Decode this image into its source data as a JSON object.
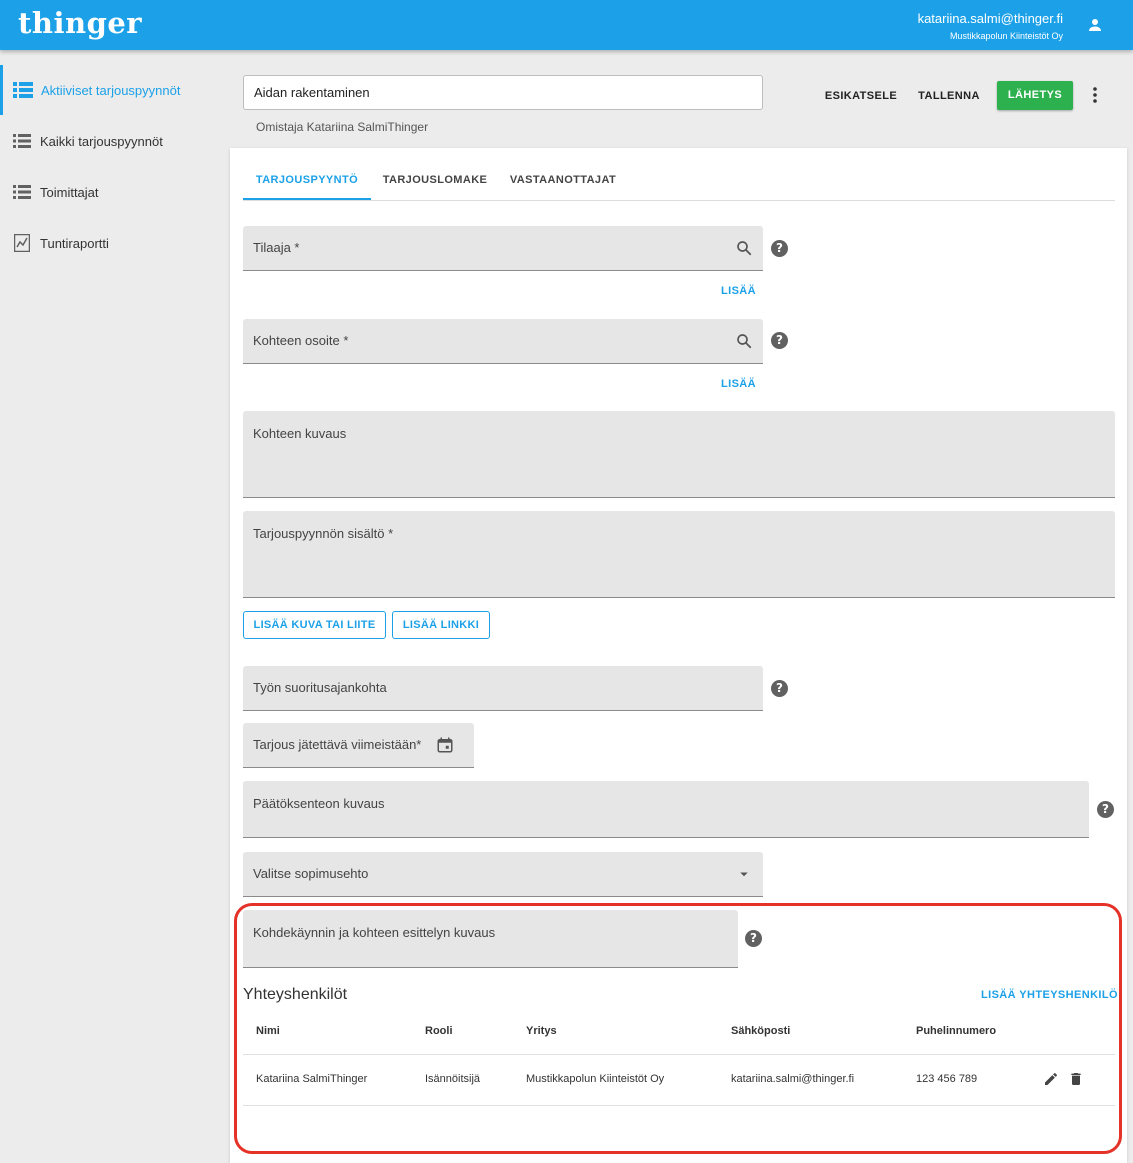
{
  "app": {
    "logo": "thinger",
    "user_email": "katariina.salmi@thinger.fi",
    "user_company": "Mustikkapolun Kiinteistöt Oy",
    "accent_color": "#1ca1e8",
    "send_color": "#2db14f",
    "highlight_color": "#e53228"
  },
  "sidebar": {
    "items": [
      {
        "label": "Aktiiviset tarjouspyynnöt",
        "icon": "grid-list-icon",
        "active": true
      },
      {
        "label": "Kaikki tarjouspyynnöt",
        "icon": "list-icon",
        "active": false
      },
      {
        "label": "Toimittajat",
        "icon": "list-icon",
        "active": false
      },
      {
        "label": "Tuntiraportti",
        "icon": "report-chart-icon",
        "active": false
      }
    ]
  },
  "header": {
    "title_value": "Aidan rakentaminen",
    "owner": "Omistaja Katariina SalmiThinger",
    "preview_label": "ESIKATSELE",
    "save_label": "TALLENNA",
    "send_label": "LÄHETYS"
  },
  "tabs": [
    "TARJOUSPYYNTÖ",
    "TARJOUSLOMAKE",
    "VASTAANOTTAJAT"
  ],
  "form": {
    "orderer_label": "Tilaaja *",
    "add_label": "LISÄÄ",
    "address_label": "Kohteen osoite *",
    "description_label": "Kohteen kuvaus",
    "content_label": "Tarjouspyynnön sisältö *",
    "add_attachment_label": "LISÄÄ KUVA TAI LIITE",
    "add_link_label": "LISÄÄ LINKKI",
    "work_time_label": "Työn suoritusajankohta",
    "deadline_label": "Tarjous jätettävä viimeistään*",
    "decision_label": "Päätöksenteon kuvaus",
    "contract_label": "Valitse sopimusehto",
    "site_visit_label": "Kohdekäynnin ja kohteen esittelyn kuvaus"
  },
  "contacts": {
    "title": "Yhteyshenkilöt",
    "add_label": "LISÄÄ YHTEYSHENKILÖ",
    "columns": [
      "Nimi",
      "Rooli",
      "Yritys",
      "Sähköposti",
      "Puhelinnumero"
    ],
    "rows": [
      {
        "name": "Katariina SalmiThinger",
        "role": "Isännöitsijä",
        "company": "Mustikkapolun Kiinteistöt Oy",
        "email": "katariina.salmi@thinger.fi",
        "phone": "123 456 789"
      }
    ]
  }
}
